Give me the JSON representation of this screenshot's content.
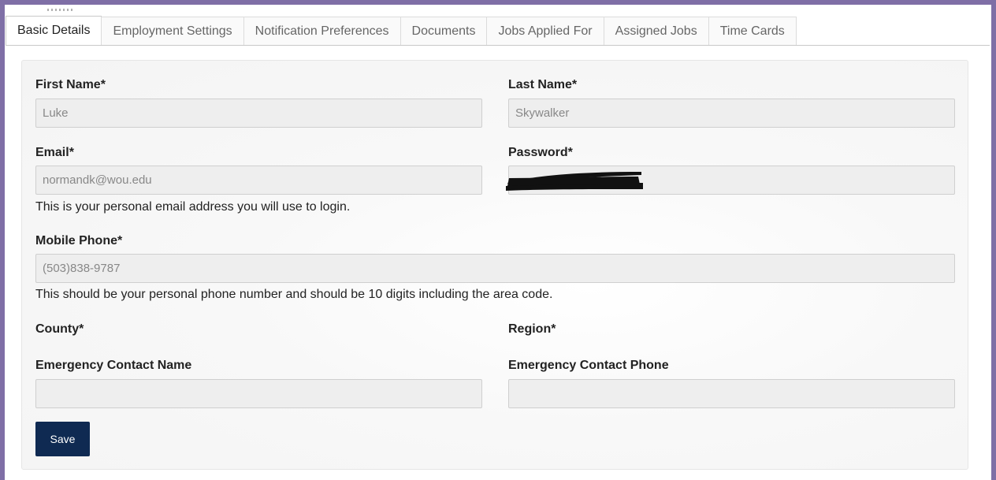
{
  "tabs": [
    {
      "label": "Basic Details",
      "active": true
    },
    {
      "label": "Employment Settings",
      "active": false
    },
    {
      "label": "Notification Preferences",
      "active": false
    },
    {
      "label": "Documents",
      "active": false
    },
    {
      "label": "Jobs Applied For",
      "active": false
    },
    {
      "label": "Assigned Jobs",
      "active": false
    },
    {
      "label": "Time Cards",
      "active": false
    }
  ],
  "form": {
    "first_name": {
      "label": "First Name*",
      "value": "Luke"
    },
    "last_name": {
      "label": "Last Name*",
      "value": "Skywalker"
    },
    "email": {
      "label": "Email*",
      "value": "normandk@wou.edu",
      "help": "This is your personal email address you will use to login."
    },
    "password": {
      "label": "Password*",
      "value": ""
    },
    "mobile_phone": {
      "label": "Mobile Phone*",
      "value": "(503)838-9787",
      "help": "This should be your personal phone number and should be 10 digits including the area code."
    },
    "county": {
      "label": "County*"
    },
    "region": {
      "label": "Region*"
    },
    "emergency_contact_name": {
      "label": "Emergency Contact Name",
      "value": ""
    },
    "emergency_contact_phone": {
      "label": "Emergency Contact Phone",
      "value": ""
    }
  },
  "actions": {
    "save_label": "Save"
  },
  "colors": {
    "frame": "#7f6fa6",
    "save_button": "#0f2a52",
    "input_bg": "#eeeeee"
  }
}
